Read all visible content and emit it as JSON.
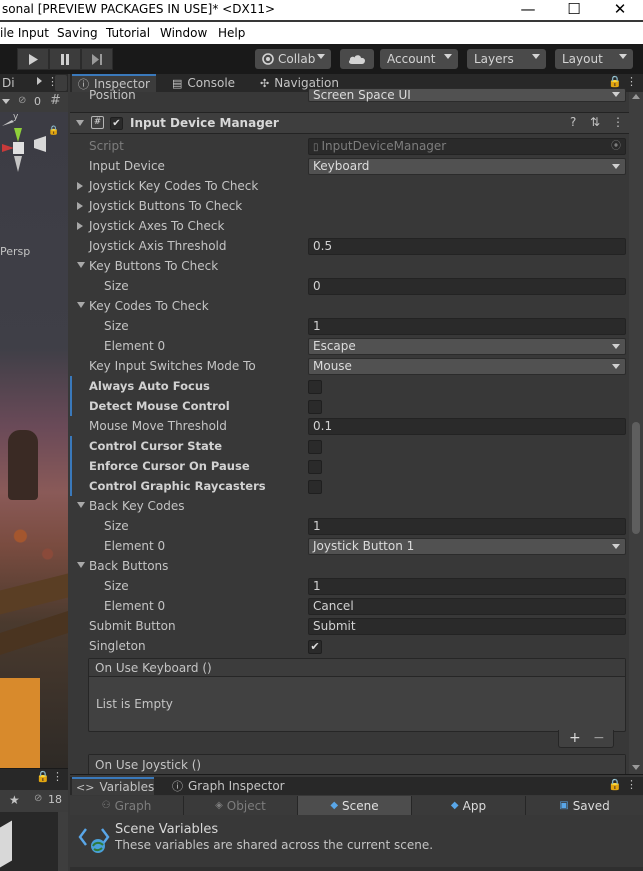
{
  "window": {
    "title": "sonal [PREVIEW PACKAGES IN USE]* <DX11>",
    "minimize_glyph": "—",
    "maximize_glyph": "☐",
    "close_glyph": "✕"
  },
  "menu": {
    "items": [
      "ile Input",
      "Saving",
      "Tutorial",
      "Window",
      "Help"
    ]
  },
  "toolbar": {
    "collab_label": "Collab",
    "account_label": "Account",
    "layers_label": "Layers",
    "layout_label": "Layout"
  },
  "left_panel": {
    "tab_label": "Di",
    "layers_count": "0",
    "gizmo_axis": "y",
    "view_label": "Persp",
    "bottom_count": "18"
  },
  "inspector": {
    "tabs": [
      {
        "label": "Inspector",
        "icon": "info-icon"
      },
      {
        "label": "Console",
        "icon": "console-icon"
      },
      {
        "label": "Navigation",
        "icon": "navigation-icon"
      }
    ],
    "position_label": "Position",
    "position_value": "Screen Space UI",
    "component_title": "Input Device Manager",
    "fields": {
      "script_label": "Script",
      "script_value": "InputDeviceManager",
      "input_device_label": "Input Device",
      "input_device_value": "Keyboard",
      "joystick_key_codes_label": "Joystick Key Codes To Check",
      "joystick_buttons_label": "Joystick Buttons To Check",
      "joystick_axes_label": "Joystick Axes To Check",
      "joystick_axis_threshold_label": "Joystick Axis Threshold",
      "joystick_axis_threshold_value": "0.5",
      "key_buttons_label": "Key Buttons To Check",
      "key_buttons_size_label": "Size",
      "key_buttons_size_value": "0",
      "key_codes_label": "Key Codes To Check",
      "key_codes_size_label": "Size",
      "key_codes_size_value": "1",
      "key_codes_element0_label": "Element 0",
      "key_codes_element0_value": "Escape",
      "key_input_switch_label": "Key Input Switches Mode To",
      "key_input_switch_value": "Mouse",
      "always_auto_focus_label": "Always Auto Focus",
      "detect_mouse_control_label": "Detect Mouse Control",
      "mouse_move_threshold_label": "Mouse Move Threshold",
      "mouse_move_threshold_value": "0.1",
      "control_cursor_state_label": "Control Cursor State",
      "enforce_cursor_label": "Enforce Cursor On Pause",
      "control_graphic_raycasters_label": "Control Graphic Raycasters",
      "back_key_codes_label": "Back Key Codes",
      "back_key_codes_size_label": "Size",
      "back_key_codes_size_value": "1",
      "back_key_codes_element0_label": "Element 0",
      "back_key_codes_element0_value": "Joystick Button 1",
      "back_buttons_label": "Back Buttons",
      "back_buttons_size_label": "Size",
      "back_buttons_size_value": "1",
      "back_buttons_element0_label": "Element 0",
      "back_buttons_element0_value": "Cancel",
      "submit_button_label": "Submit Button",
      "submit_button_value": "Submit",
      "singleton_label": "Singleton",
      "singleton_checked": true,
      "check_glyph": "✔"
    },
    "events": {
      "on_use_keyboard_label": "On Use Keyboard ()",
      "on_use_keyboard_empty": "List is Empty",
      "add_glyph": "+",
      "remove_glyph": "−",
      "on_use_joystick_label": "On Use Joystick ()"
    }
  },
  "bottom_panel": {
    "tabs": [
      {
        "label": "Variables",
        "icon": "variables-icon"
      },
      {
        "label": "Graph Inspector",
        "icon": "graph-inspector-icon"
      }
    ],
    "scope_tabs": [
      {
        "label": "Graph",
        "icon": "graph-icon"
      },
      {
        "label": "Object",
        "icon": "object-icon"
      },
      {
        "label": "Scene",
        "icon": "scene-icon"
      },
      {
        "label": "App",
        "icon": "app-icon"
      },
      {
        "label": "Saved",
        "icon": "saved-icon"
      }
    ],
    "scene_variables_title": "Scene Variables",
    "scene_variables_desc": "These variables are shared across the current scene."
  },
  "colors": {
    "accent": "#3a79bb",
    "panel_bg": "#383838",
    "toolbar_bg": "#191919"
  }
}
